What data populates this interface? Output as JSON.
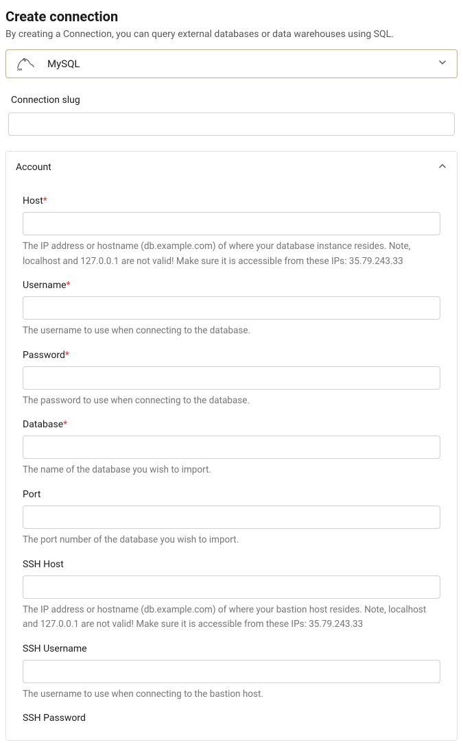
{
  "header": {
    "title": "Create connection",
    "subtitle": "By creating a Connection, you can query external databases or data warehouses using SQL."
  },
  "db_select": {
    "label": "MySQL",
    "icon": "mysql-dolphin"
  },
  "slug": {
    "label": "Connection slug",
    "value": ""
  },
  "account_section": {
    "title": "Account",
    "fields": {
      "host": {
        "label": "Host",
        "required": true,
        "value": "",
        "help": "The IP address or hostname (db.example.com) of where your database instance resides. Note, localhost and 127.0.0.1 are not valid! Make sure it is accessible from these IPs: 35.79.243.33"
      },
      "username": {
        "label": "Username",
        "required": true,
        "value": "",
        "help": "The username to use when connecting to the database."
      },
      "password": {
        "label": "Password",
        "required": true,
        "value": "",
        "help": "The password to use when connecting to the database."
      },
      "database": {
        "label": "Database",
        "required": true,
        "value": "",
        "help": "The name of the database you wish to import."
      },
      "port": {
        "label": "Port",
        "required": false,
        "value": "",
        "help": "The port number of the database you wish to import."
      },
      "ssh_host": {
        "label": "SSH Host",
        "required": false,
        "value": "",
        "help": "The IP address or hostname (db.example.com) of where your bastion host resides. Note, localhost and 127.0.0.1 are not valid! Make sure it is accessible from these IPs: 35.79.243.33"
      },
      "ssh_username": {
        "label": "SSH Username",
        "required": false,
        "value": "",
        "help": "The username to use when connecting to the bastion host."
      },
      "ssh_password": {
        "label": "SSH Password",
        "required": false,
        "value": "",
        "help": ""
      }
    }
  },
  "required_marker": "*"
}
